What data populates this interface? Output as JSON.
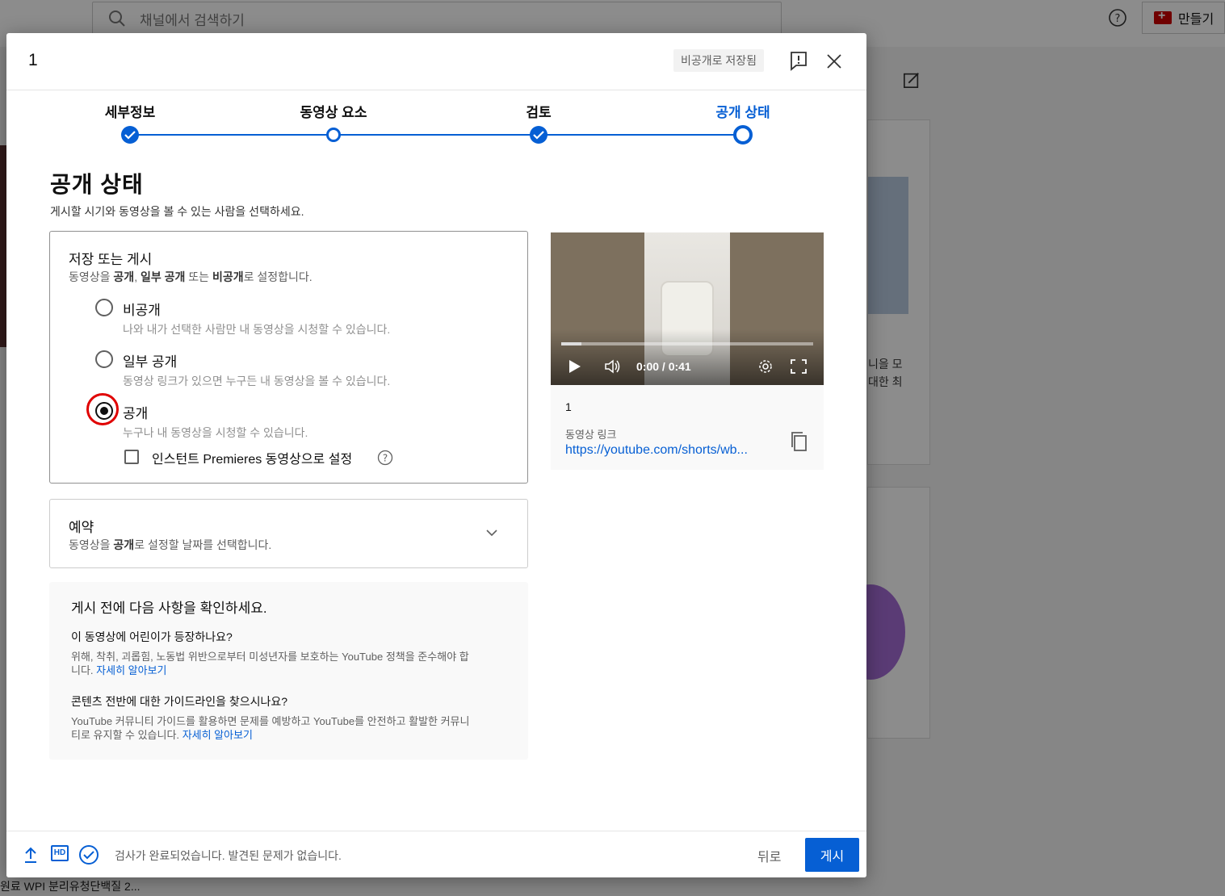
{
  "background": {
    "search_placeholder": "채널에서 검색하기",
    "create_label": "만들기",
    "card_text_1": "니을 모",
    "card_text_2": "대한 최",
    "bottom_text": "원료 WPI 분리유청단백질 2..."
  },
  "dialog": {
    "title": "1",
    "saved_status": "비공개로 저장됨"
  },
  "stepper": {
    "steps": [
      {
        "label": "세부정보",
        "state": "done"
      },
      {
        "label": "동영상 요소",
        "state": "open"
      },
      {
        "label": "검토",
        "state": "done"
      },
      {
        "label": "공개 상태",
        "state": "current"
      }
    ]
  },
  "visibility": {
    "title": "공개 상태",
    "subtitle": "게시할 시기와 동영상을 볼 수 있는 사람을 선택하세요.",
    "save_box": {
      "heading": "저장 또는 게시",
      "desc_prefix": "동영상을 ",
      "desc_public": "공개",
      "desc_sep1": ", ",
      "desc_unlisted": "일부 공개",
      "desc_mid": " 또는 ",
      "desc_private": "비공개",
      "desc_suffix": "로 설정합니다.",
      "options": [
        {
          "label": "비공개",
          "desc": "나와 내가 선택한 사람만 내 동영상을 시청할 수 있습니다.",
          "checked": false
        },
        {
          "label": "일부 공개",
          "desc": "동영상 링크가 있으면 누구든 내 동영상을 볼 수 있습니다.",
          "checked": false
        },
        {
          "label": "공개",
          "desc": "누구나 내 동영상을 시청할 수 있습니다.",
          "checked": true
        }
      ],
      "premiere_label": "인스턴트 Premieres 동영상으로 설정"
    },
    "schedule": {
      "heading": "예약",
      "desc_prefix": "동영상을 ",
      "desc_bold": "공개",
      "desc_suffix": "로 설정할 날짜를 선택합니다."
    },
    "checklist": {
      "title": "게시 전에 다음 사항을 확인하세요.",
      "q1": "이 동영상에 어린이가 등장하나요?",
      "a1": "위해, 착취, 괴롭힘, 노동법 위반으로부터 미성년자를 보호하는 YouTube 정책을 준수해야 합니다.",
      "q2": "콘텐츠 전반에 대한 가이드라인을 찾으시나요?",
      "a2": "YouTube 커뮤니티 가이드를 활용하면 문제를 예방하고 YouTube를 안전하고 활발한 커뮤니티로 유지할 수 있습니다.",
      "learn_more": "자세히 알아보기"
    }
  },
  "preview": {
    "time": "0:00 / 0:41",
    "progress": 0.08,
    "video_name": "1",
    "link_label": "동영상 링크",
    "link_url": "https://youtube.com/shorts/wb..."
  },
  "footer": {
    "status": "검사가 완료되었습니다. 발견된 문제가 없습니다.",
    "hd": "HD",
    "back_label": "뒤로",
    "publish_label": "게시"
  },
  "colors": {
    "accent": "#065fd4",
    "highlight_ring": "#e00000"
  }
}
